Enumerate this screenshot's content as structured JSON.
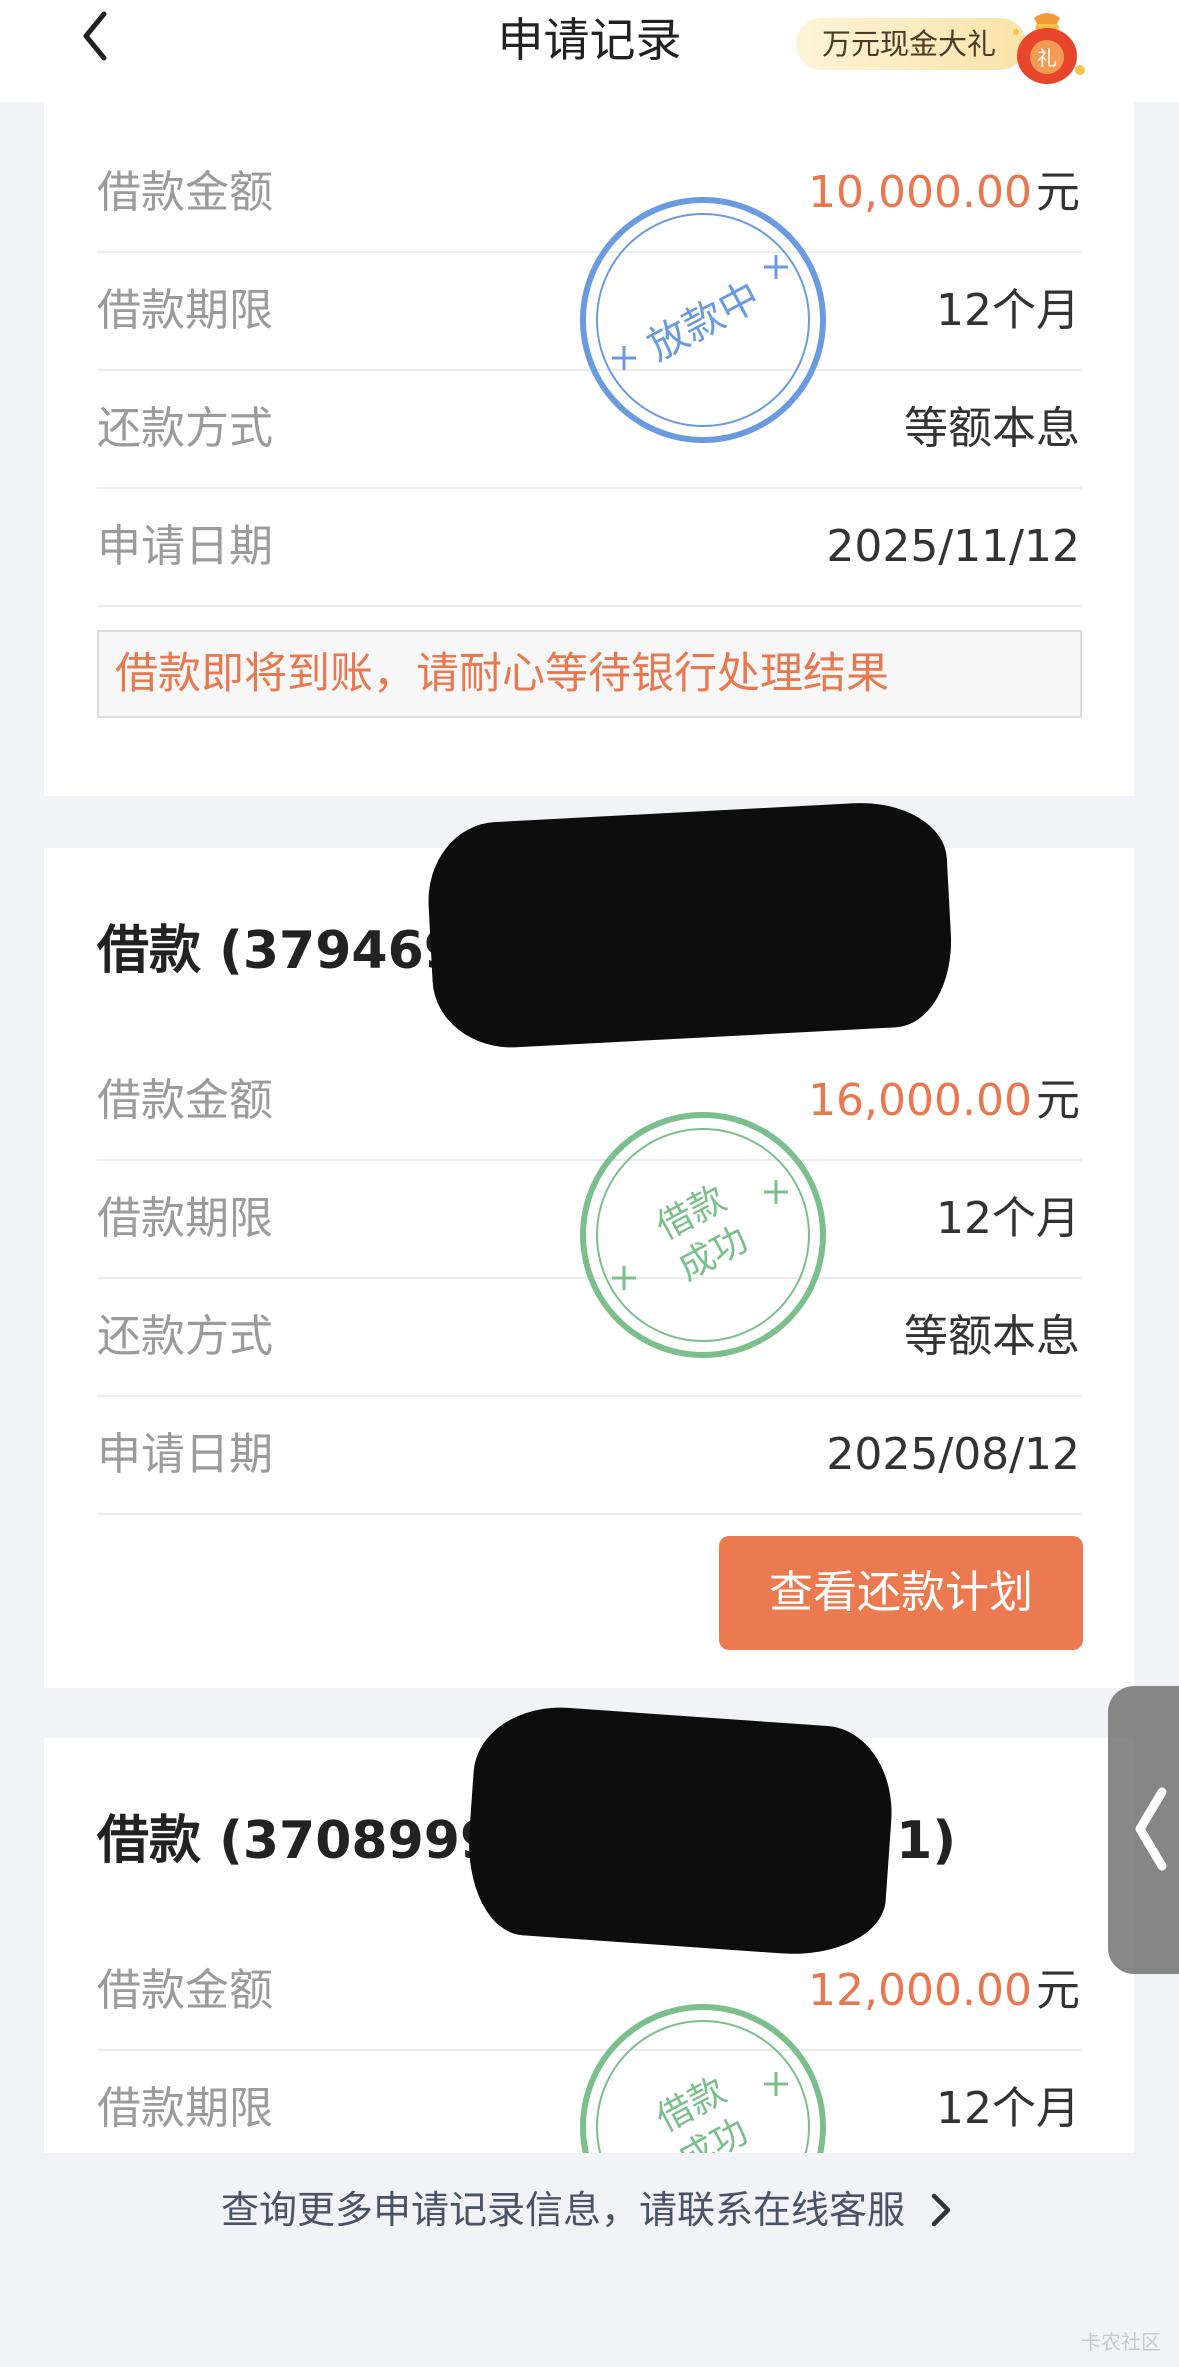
{
  "header": {
    "title": "申请记录",
    "gift_label": "万元现金大礼",
    "gift_bag_char": "礼"
  },
  "records": [
    {
      "title": "",
      "amount_value": "10,000.00",
      "amount_unit": "元",
      "rows": [
        {
          "label": "借款金额"
        },
        {
          "label": "借款期限",
          "value": "12个月"
        },
        {
          "label": "还款方式",
          "value": "等额本息"
        },
        {
          "label": "申请日期",
          "value": "2025/11/12"
        }
      ],
      "stamp": {
        "lines": [
          "放款中"
        ],
        "color": "#6a9be0"
      },
      "notice": "借款即将到账，请耐心等待银行处理结果"
    },
    {
      "title": "借款 (37946946000000000)",
      "title_visible": "借款 (37946946",
      "amount_value": "16,000.00",
      "amount_unit": "元",
      "rows": [
        {
          "label": "借款金额"
        },
        {
          "label": "借款期限",
          "value": "12个月"
        },
        {
          "label": "还款方式",
          "value": "等额本息"
        },
        {
          "label": "申请日期",
          "value": "2025/08/12"
        }
      ],
      "stamp": {
        "lines": [
          "借款",
          "成功"
        ],
        "color": "#7bbf8c"
      },
      "button_label": "查看还款计划"
    },
    {
      "title_visible": "借款 (3708999",
      "title_tail": "1)",
      "amount_value": "12,000.00",
      "amount_unit": "元",
      "rows": [
        {
          "label": "借款金额"
        },
        {
          "label": "借款期限",
          "value": "12个月"
        }
      ],
      "stamp": {
        "lines": [
          "借款",
          "成功"
        ],
        "color": "#7bbf8c"
      }
    }
  ],
  "footer": {
    "link_text": "查询更多申请记录信息，请联系在线客服"
  },
  "watermark": "卡农社区",
  "colors": {
    "accent_orange": "#e8784f",
    "button_orange": "#ec7a51",
    "stamp_blue": "#6a9be0",
    "stamp_green": "#7bbf8c",
    "label_gray": "#9b9b9b",
    "page_bg": "#f2f3f7"
  },
  "icons": {
    "back": "chevron-left-icon",
    "gift": "red-gift-bag-icon",
    "footer_arrow": "chevron-right-icon",
    "side_tab": "chevron-left-icon"
  }
}
